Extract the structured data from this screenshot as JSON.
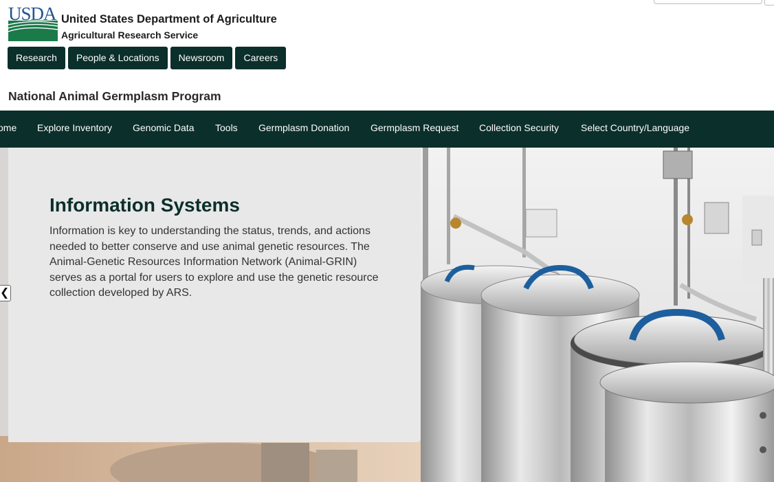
{
  "header": {
    "logo_text": "USDA",
    "agency_name": "United States Department of Agriculture",
    "agency_sub": "Agricultural Research Service"
  },
  "top_nav": [
    "Research",
    "People & Locations",
    "Newsroom",
    "Careers"
  ],
  "program_title": "National Animal Germplasm Program",
  "main_nav": [
    "ome",
    "Explore Inventory",
    "Genomic Data",
    "Tools",
    "Germplasm Donation",
    "Germplasm Request",
    "Collection Security",
    "Select Country/Language"
  ],
  "hero": {
    "title": "Information Systems",
    "body": "Information is key to understanding the status, trends, and actions needed to better conserve and use animal genetic resources. The Animal-Genetic Resources Information Network (Animal-GRIN) serves as a portal for users to explore and use the genetic resource collection developed by ARS.",
    "prev_icon": "chevron-left-icon"
  },
  "colors": {
    "nav_bg": "#0b2f2a",
    "usda_blue": "#205493",
    "usda_green": "#1a7a4a",
    "title_color": "#0b2f2a"
  }
}
